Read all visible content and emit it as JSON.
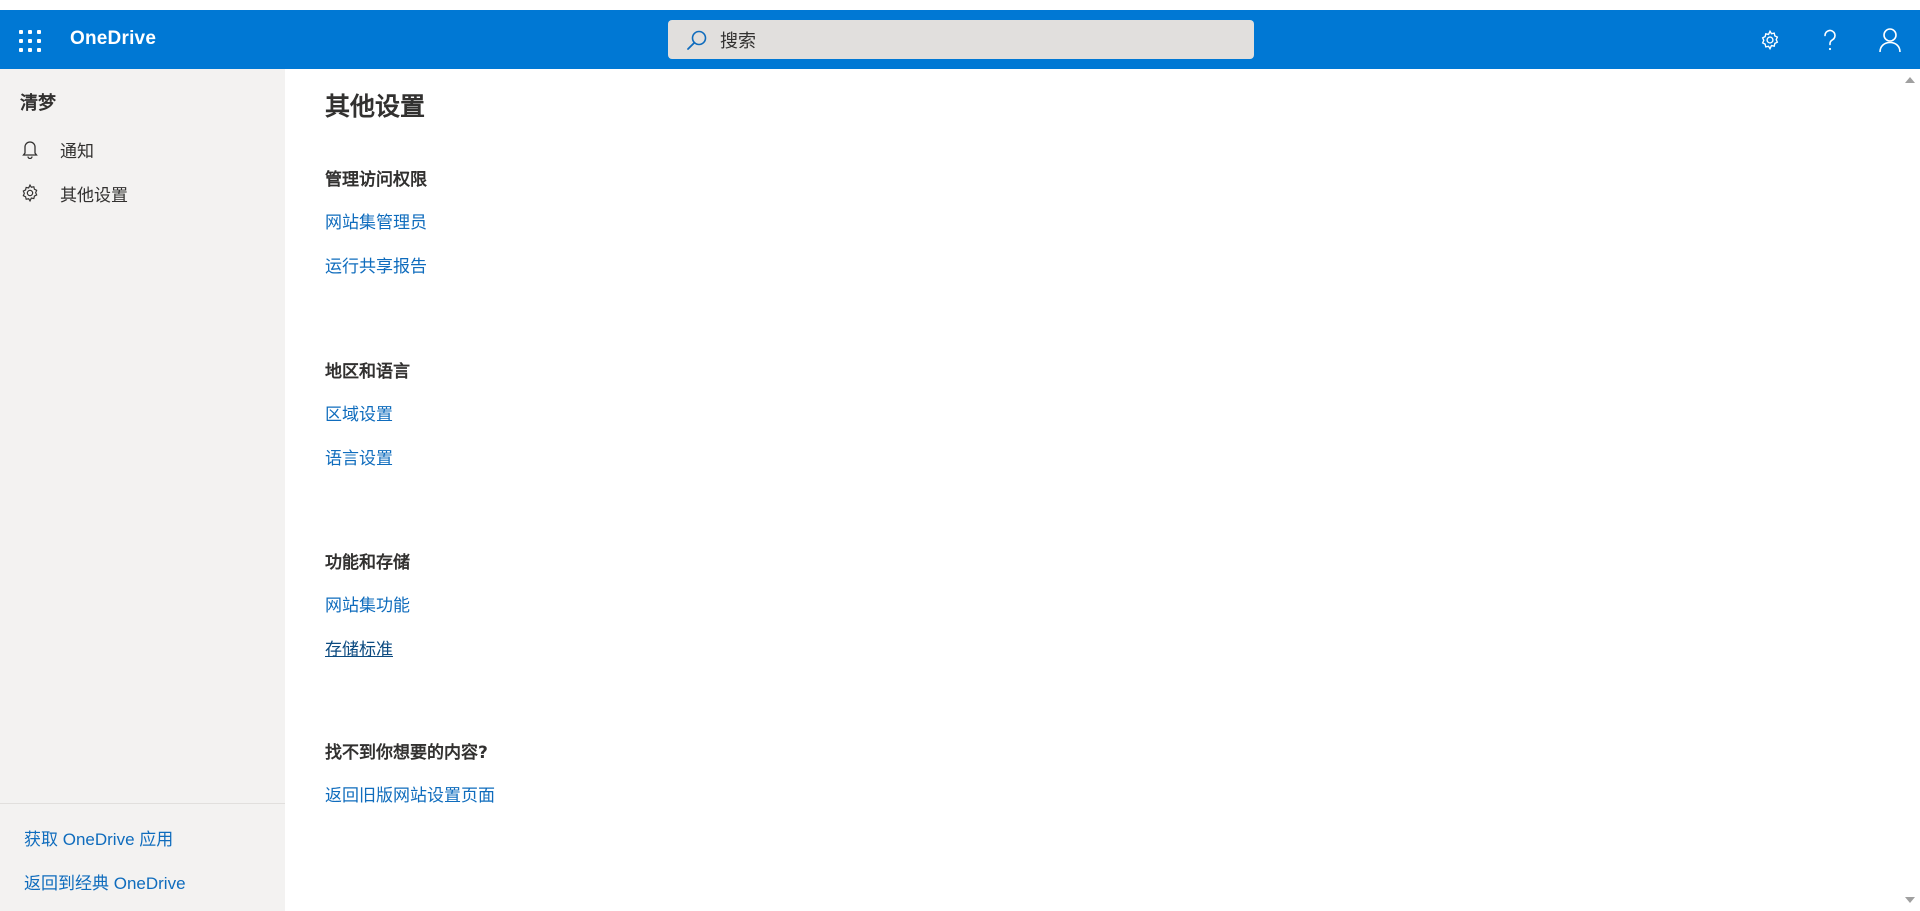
{
  "header": {
    "app_name": "OneDrive",
    "search_placeholder": "搜索",
    "icons": [
      "app-launcher-icon",
      "search-icon",
      "settings-gear-icon",
      "help-icon",
      "account-icon"
    ],
    "accent_color": "#0078d4"
  },
  "sidebar": {
    "user_name": "清梦",
    "items": [
      {
        "label": "通知",
        "icon": "bell-icon"
      },
      {
        "label": "其他设置",
        "icon": "gear-icon"
      }
    ],
    "footer_links": [
      "获取 OneDrive 应用",
      "返回到经典 OneDrive"
    ]
  },
  "main": {
    "title": "其他设置",
    "sections": [
      {
        "title": "管理访问权限",
        "links": [
          "网站集管理员",
          "运行共享报告"
        ]
      },
      {
        "title": "地区和语言",
        "links": [
          "区域设置",
          "语言设置"
        ]
      },
      {
        "title": "功能和存储",
        "links": [
          "网站集功能",
          "存储标准"
        ]
      },
      {
        "title": "找不到你想要的内容?",
        "links": [
          "返回旧版网站设置页面"
        ]
      }
    ]
  },
  "colors": {
    "link": "#0f6cbd",
    "sidebar_bg": "#f3f2f1"
  }
}
